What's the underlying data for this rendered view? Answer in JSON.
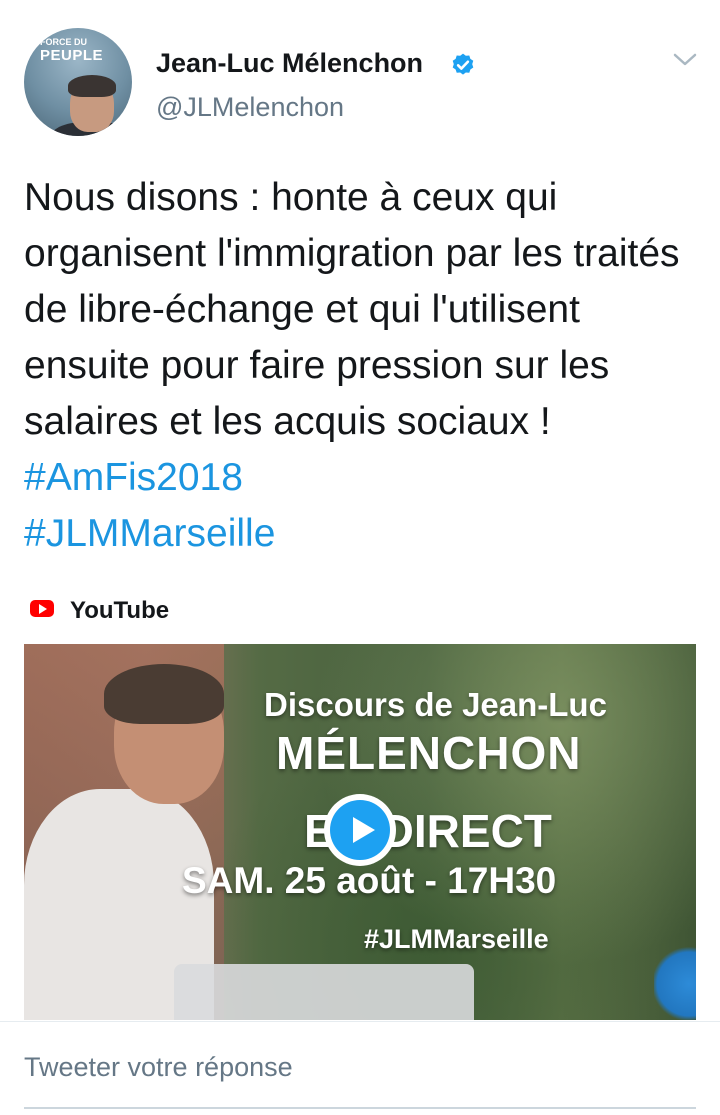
{
  "author": {
    "name": "Jean-Luc Mélenchon",
    "handle": "@JLMelenchon",
    "avatar_text_top": "FORCE DU",
    "avatar_text_bottom": "PEUPLE"
  },
  "tweet": {
    "text": "Nous disons : honte à ceux qui organisent l'immigration par les traités de libre-échange et qui l'utilisent ensuite pour faire pression sur les salaires et les acquis sociaux ! ",
    "hashtag1": "#AmFis2018",
    "hashtag2": "#JLMMarseille"
  },
  "card": {
    "source": "YouTube",
    "overlay_line1": "Discours de Jean-Luc",
    "overlay_line2": "MÉLENCHON",
    "overlay_line3": "EN DIRECT",
    "overlay_line4": "SAM. 25 août - 17H30",
    "overlay_line5": "#JLMMarseille"
  },
  "reply": {
    "placeholder": "Tweeter votre réponse"
  },
  "colors": {
    "link": "#1b95e0",
    "verified": "#1da1f2",
    "secondary_text": "#657786",
    "youtube_red": "#ff0000"
  },
  "icons": {
    "verified": "verified-badge-icon",
    "caret": "chevron-down-icon",
    "youtube": "youtube-logo-icon",
    "play": "play-icon"
  }
}
